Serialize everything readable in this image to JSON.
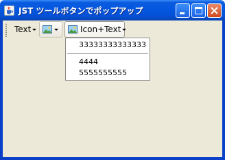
{
  "window": {
    "title": "JST ツールボタンでポップアップ"
  },
  "toolbar": {
    "text_button_label": "Text",
    "icon_text_button_label": "Icon+Text"
  },
  "popup": {
    "items": [
      {
        "label": "33333333333333"
      },
      {
        "label": "4444"
      },
      {
        "label": "5555555555"
      }
    ]
  },
  "colors": {
    "titlebar": "#0a5bde",
    "client_background": "#ece9d8",
    "close_button": "#d24a1d"
  }
}
